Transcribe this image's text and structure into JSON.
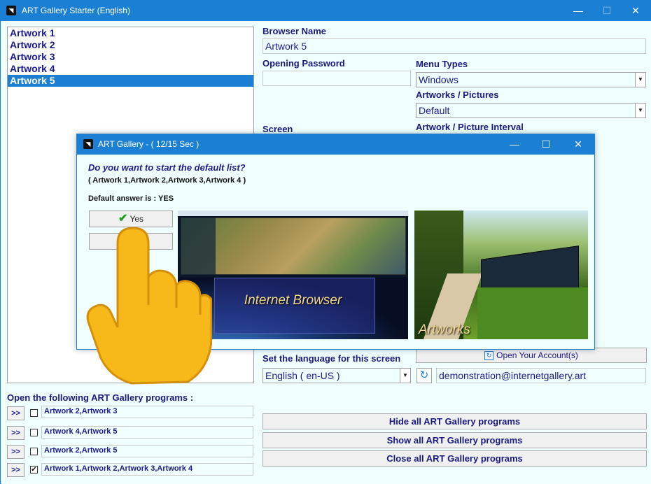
{
  "window": {
    "title": "ART Gallery Starter (English)",
    "minimize": "—",
    "maximize": "☐",
    "close": "✕"
  },
  "artworks_list": [
    "Artwork 1",
    "Artwork 2",
    "Artwork 3",
    "Artwork 4",
    "Artwork 5"
  ],
  "selected_artwork": "Artwork 5",
  "form": {
    "browser_name_label": "Browser Name",
    "browser_name_value": "Artwork 5",
    "opening_password_label": "Opening Password",
    "opening_password_value": "",
    "menu_types_label": "Menu Types",
    "menu_types_value": "Windows",
    "artworks_pictures_label": "Artworks / Pictures",
    "artworks_pictures_value": "Default",
    "screen_label": "Screen",
    "interval_label": "Artwork / Picture Interval",
    "open_account_label": "Open Your Account(s)",
    "language_label": "Set the language for this screen",
    "language_value": "English ( en-US )",
    "email_value": "demonstration@internetgallery.art"
  },
  "programs": {
    "title": "Open the following ART Gallery programs :",
    "button_label": ">>",
    "rows": [
      {
        "label": "Artwork 2,Artwork 3",
        "checked": false,
        "mark": ""
      },
      {
        "label": "Artwork 4,Artwork 5",
        "checked": false,
        "mark": ""
      },
      {
        "label": "Artwork 2,Artwork 5",
        "checked": false,
        "mark": ""
      },
      {
        "label": "Artwork 1,Artwork 2,Artwork 3,Artwork 4",
        "checked": true,
        "mark": "✔"
      }
    ],
    "hide_all": "Hide all ART Gallery programs",
    "show_all": "Show all ART Gallery programs",
    "close_all": "Close all ART Gallery programs"
  },
  "dialog": {
    "title": "ART Gallery -   ( 12/15 Sec )",
    "question": "Do you want to start the default list?",
    "list_text": "( Artwork 1,Artwork 2,Artwork 3,Artwork 4 )",
    "default_answer": "Default answer is : YES",
    "yes_label": "Yes",
    "no_label": "",
    "image1_caption": "Internet Browser",
    "image2_caption": "Artworks"
  },
  "colors": {
    "accent": "#1b7fd4",
    "text_dark_blue": "#1a1a80",
    "background": "#f0ffff"
  }
}
